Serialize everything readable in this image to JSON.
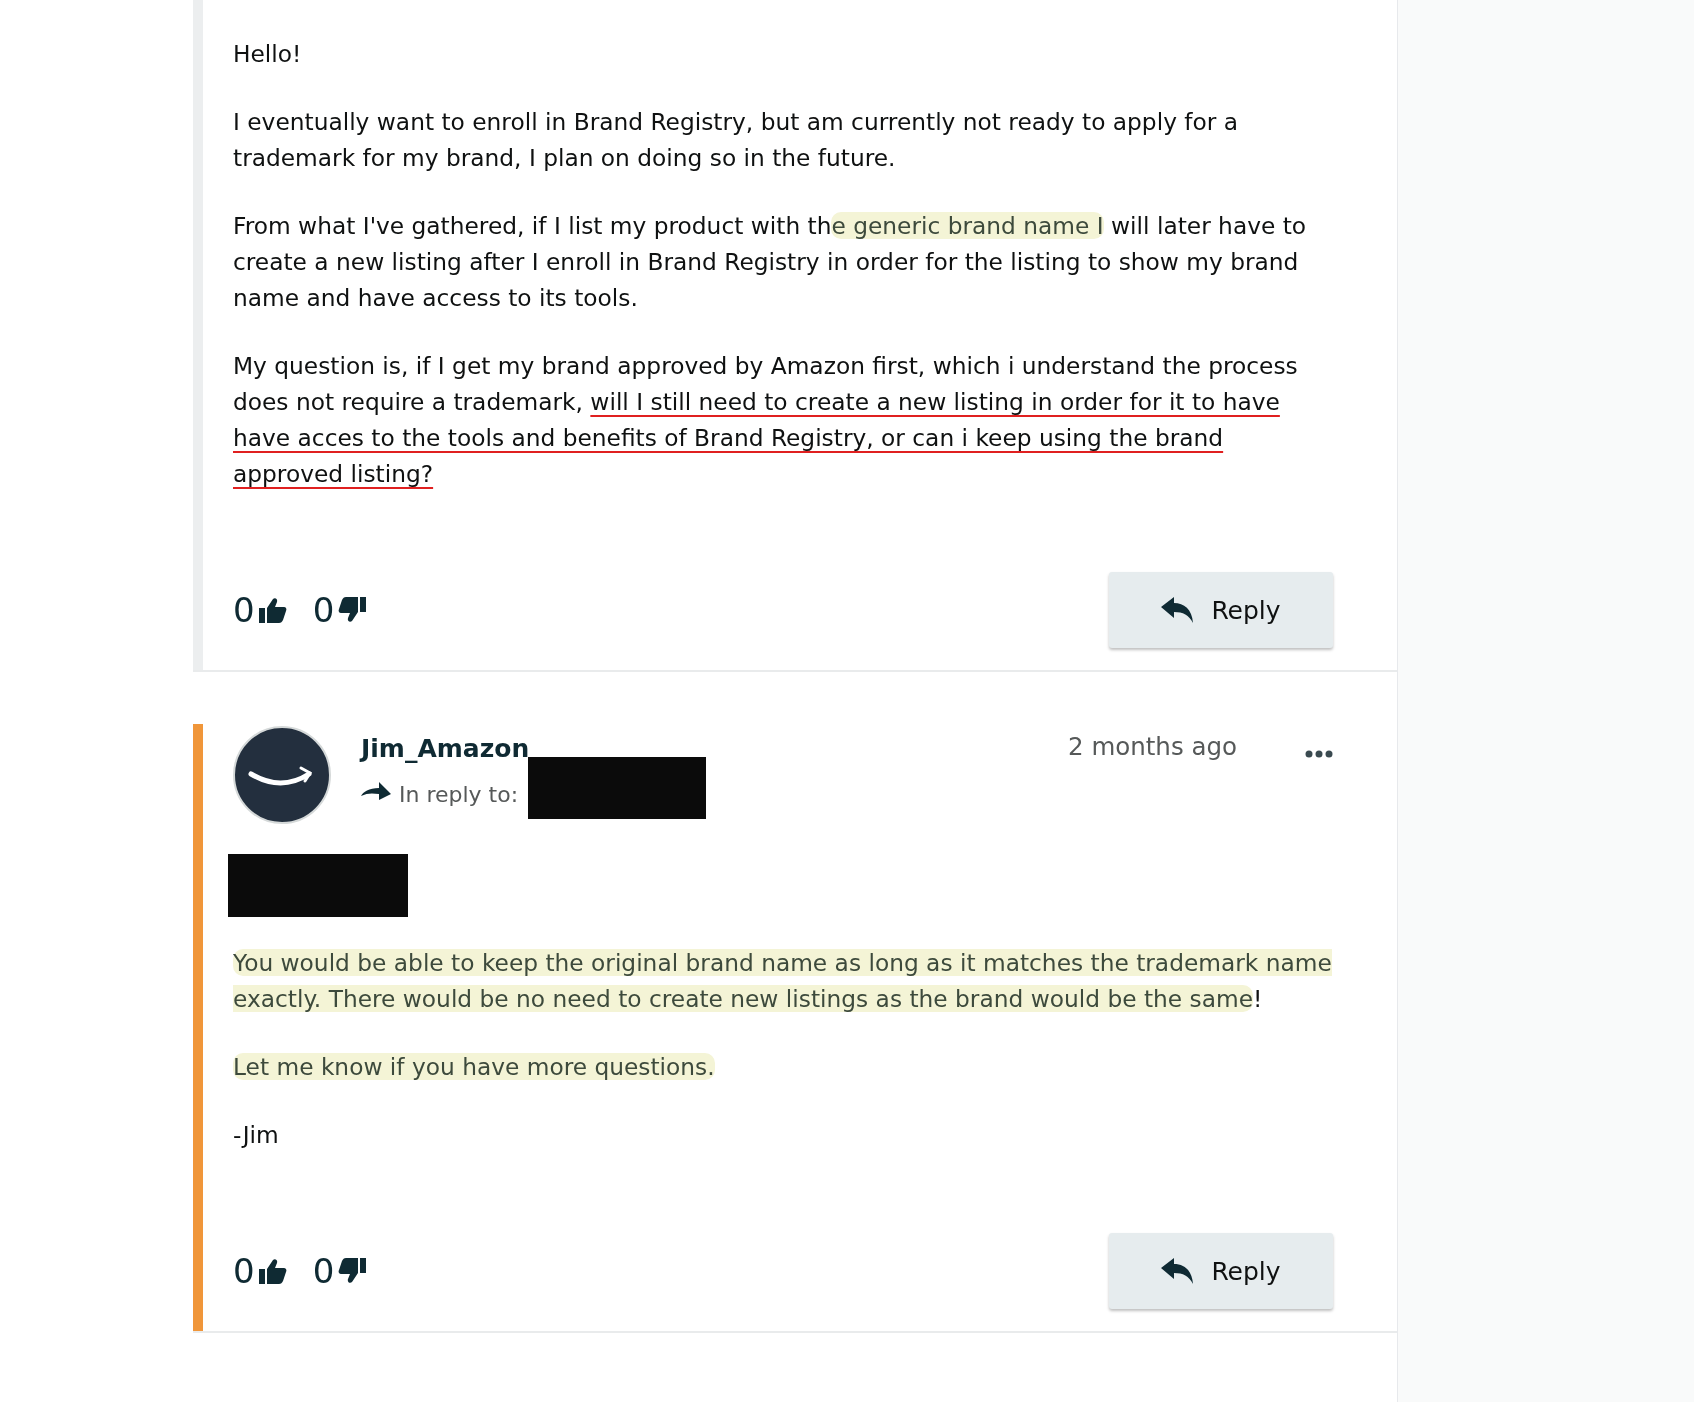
{
  "posts": [
    {
      "staff": false,
      "redacted_greeting": false,
      "paragraphs": [
        [
          {
            "text": "Hello!",
            "highlighted": false,
            "underlined": false
          }
        ],
        [
          {
            "text": "I eventually want to enroll in Brand Registry, but am currently not ready to apply for a trademark for my brand, I plan on doing so in the future.",
            "highlighted": false,
            "underlined": false
          }
        ],
        [
          {
            "text": "From what I've gathered, if I list my product with th",
            "highlighted": false,
            "underlined": false
          },
          {
            "text": "e generic brand name I",
            "highlighted": true,
            "underlined": false
          },
          {
            "text": " will later have to create a new listing after I enroll in Brand Registry in order for the listing to show my brand name and have access to its tools.",
            "highlighted": false,
            "underlined": false
          }
        ],
        [
          {
            "text": "My question is, if I get my brand approved by Amazon first, which i understand the process does not require a trademark, ",
            "highlighted": false,
            "underlined": false
          },
          {
            "text": "will I still need to create a new listing in order for it to have have acces to the tools and benefits of Brand Registry, or can i keep using the brand approved listing?",
            "highlighted": false,
            "underlined": true
          }
        ]
      ],
      "upvotes": "0",
      "downvotes": "0",
      "reply_button": "Reply"
    },
    {
      "staff": true,
      "header": {
        "author": "Jim_Amazon",
        "in_reply_label": "In reply to:",
        "reply_target_redacted": true,
        "time": "2 months ago"
      },
      "redacted_greeting": true,
      "paragraphs": [
        [
          {
            "text": "You would be able to keep the original brand name as long as it matches the trademark name exactly. There would be no need to create new listings as the brand would be the same",
            "highlighted": true,
            "underlined": false
          },
          {
            "text": "!",
            "highlighted": false,
            "underlined": false
          }
        ],
        [
          {
            "text": "Let me know if you have more questions.",
            "highlighted": true,
            "underlined": false
          }
        ],
        [
          {
            "text": "-Jim",
            "highlighted": false,
            "underlined": false
          }
        ]
      ],
      "upvotes": "0",
      "downvotes": "0",
      "reply_button": "Reply"
    }
  ]
}
